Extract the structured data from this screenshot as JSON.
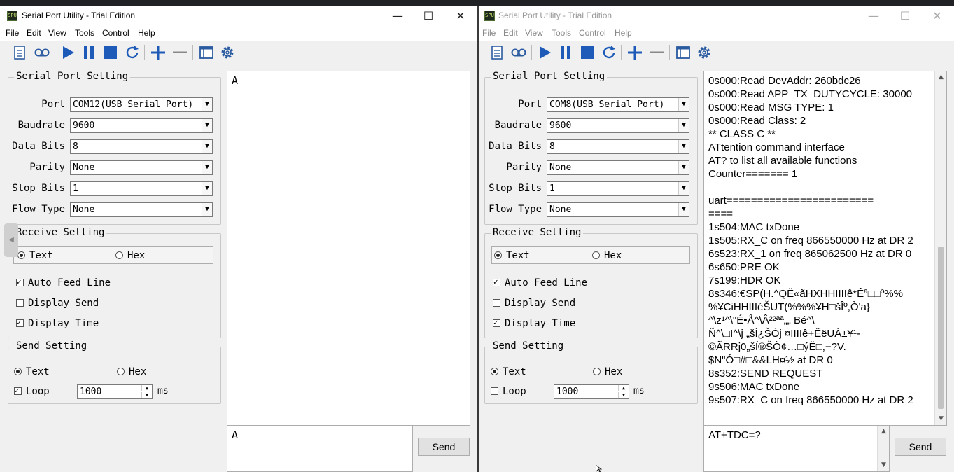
{
  "title": "Serial Port Utility - Trial Edition",
  "menu": [
    "File",
    "Edit",
    "View",
    "Tools",
    "Control",
    "Help"
  ],
  "toolbar_icons": [
    "new-file-icon",
    "loop-icon",
    "play-icon",
    "pause-icon",
    "stop-icon",
    "refresh-icon",
    "plus-icon",
    "minus-icon",
    "window-icon",
    "gear-icon"
  ],
  "labels": {
    "serial_port_setting": "Serial Port Setting",
    "port": "Port",
    "baudrate": "Baudrate",
    "data_bits": "Data Bits",
    "parity": "Parity",
    "stop_bits": "Stop Bits",
    "flow_type": "Flow Type",
    "receive_setting": "Receive Setting",
    "text": "Text",
    "hex": "Hex",
    "auto_feed_line": "Auto Feed Line",
    "display_send": "Display Send",
    "display_time": "Display Time",
    "send_setting": "Send Setting",
    "loop": "Loop",
    "ms": "ms",
    "send": "Send"
  },
  "windowA": {
    "port": "COM12(USB Serial Port)",
    "baudrate": "9600",
    "data_bits": "8",
    "parity": "None",
    "stop_bits": "1",
    "flow_type": "None",
    "auto_feed_line": true,
    "display_send": false,
    "display_time": true,
    "loop": true,
    "loop_ms": "1000",
    "output": "A",
    "send_text": "A"
  },
  "windowB": {
    "port": "COM8(USB Serial Port)",
    "baudrate": "9600",
    "data_bits": "8",
    "parity": "None",
    "stop_bits": "1",
    "flow_type": "None",
    "auto_feed_line": true,
    "display_send": false,
    "display_time": true,
    "loop": false,
    "loop_ms": "1000",
    "output_lines": [
      "0s000:Read DevAddr: 260bdc26",
      "0s000:Read APP_TX_DUTYCYCLE: 30000",
      "0s000:Read MSG TYPE: 1",
      "0s000:Read Class: 2",
      "** CLASS C **",
      "ATtention command interface",
      "AT? to list all available functions",
      "Counter======= 1",
      "",
      "uart========================",
      "====",
      "1s504:MAC txDone",
      "1s505:RX_C on freq 866550000 Hz at DR 2",
      "6s523:RX_1 on freq 865062500 Hz at DR 0",
      "6s650:PRE OK",
      "7s199:HDR OK",
      "8s346:€SP(H.^QË«ãHXHHIIIIê*Êª□□º%%",
      "%¥CiHHIIIéŠUT(%%%¥H□šÎº,Ò'a}",
      "^\\z¹^\\\"É•Å^\\Â²²ªª„„ Bé^\\",
      "Ñ^\\□I^\\j „šÍ¿ŠÒj ¤IIIIê+ËëUÁ±¥¹-",
      "©ÃRRj0„šÍ®ŠÒ¢…□ýË□,−?V.",
      "$N\"Ó□#□&&LH¤½ at DR 0",
      "8s352:SEND REQUEST",
      "9s506:MAC txDone",
      "9s507:RX_C on freq 866550000 Hz at DR 2"
    ],
    "send_text": "AT+TDC=?"
  }
}
